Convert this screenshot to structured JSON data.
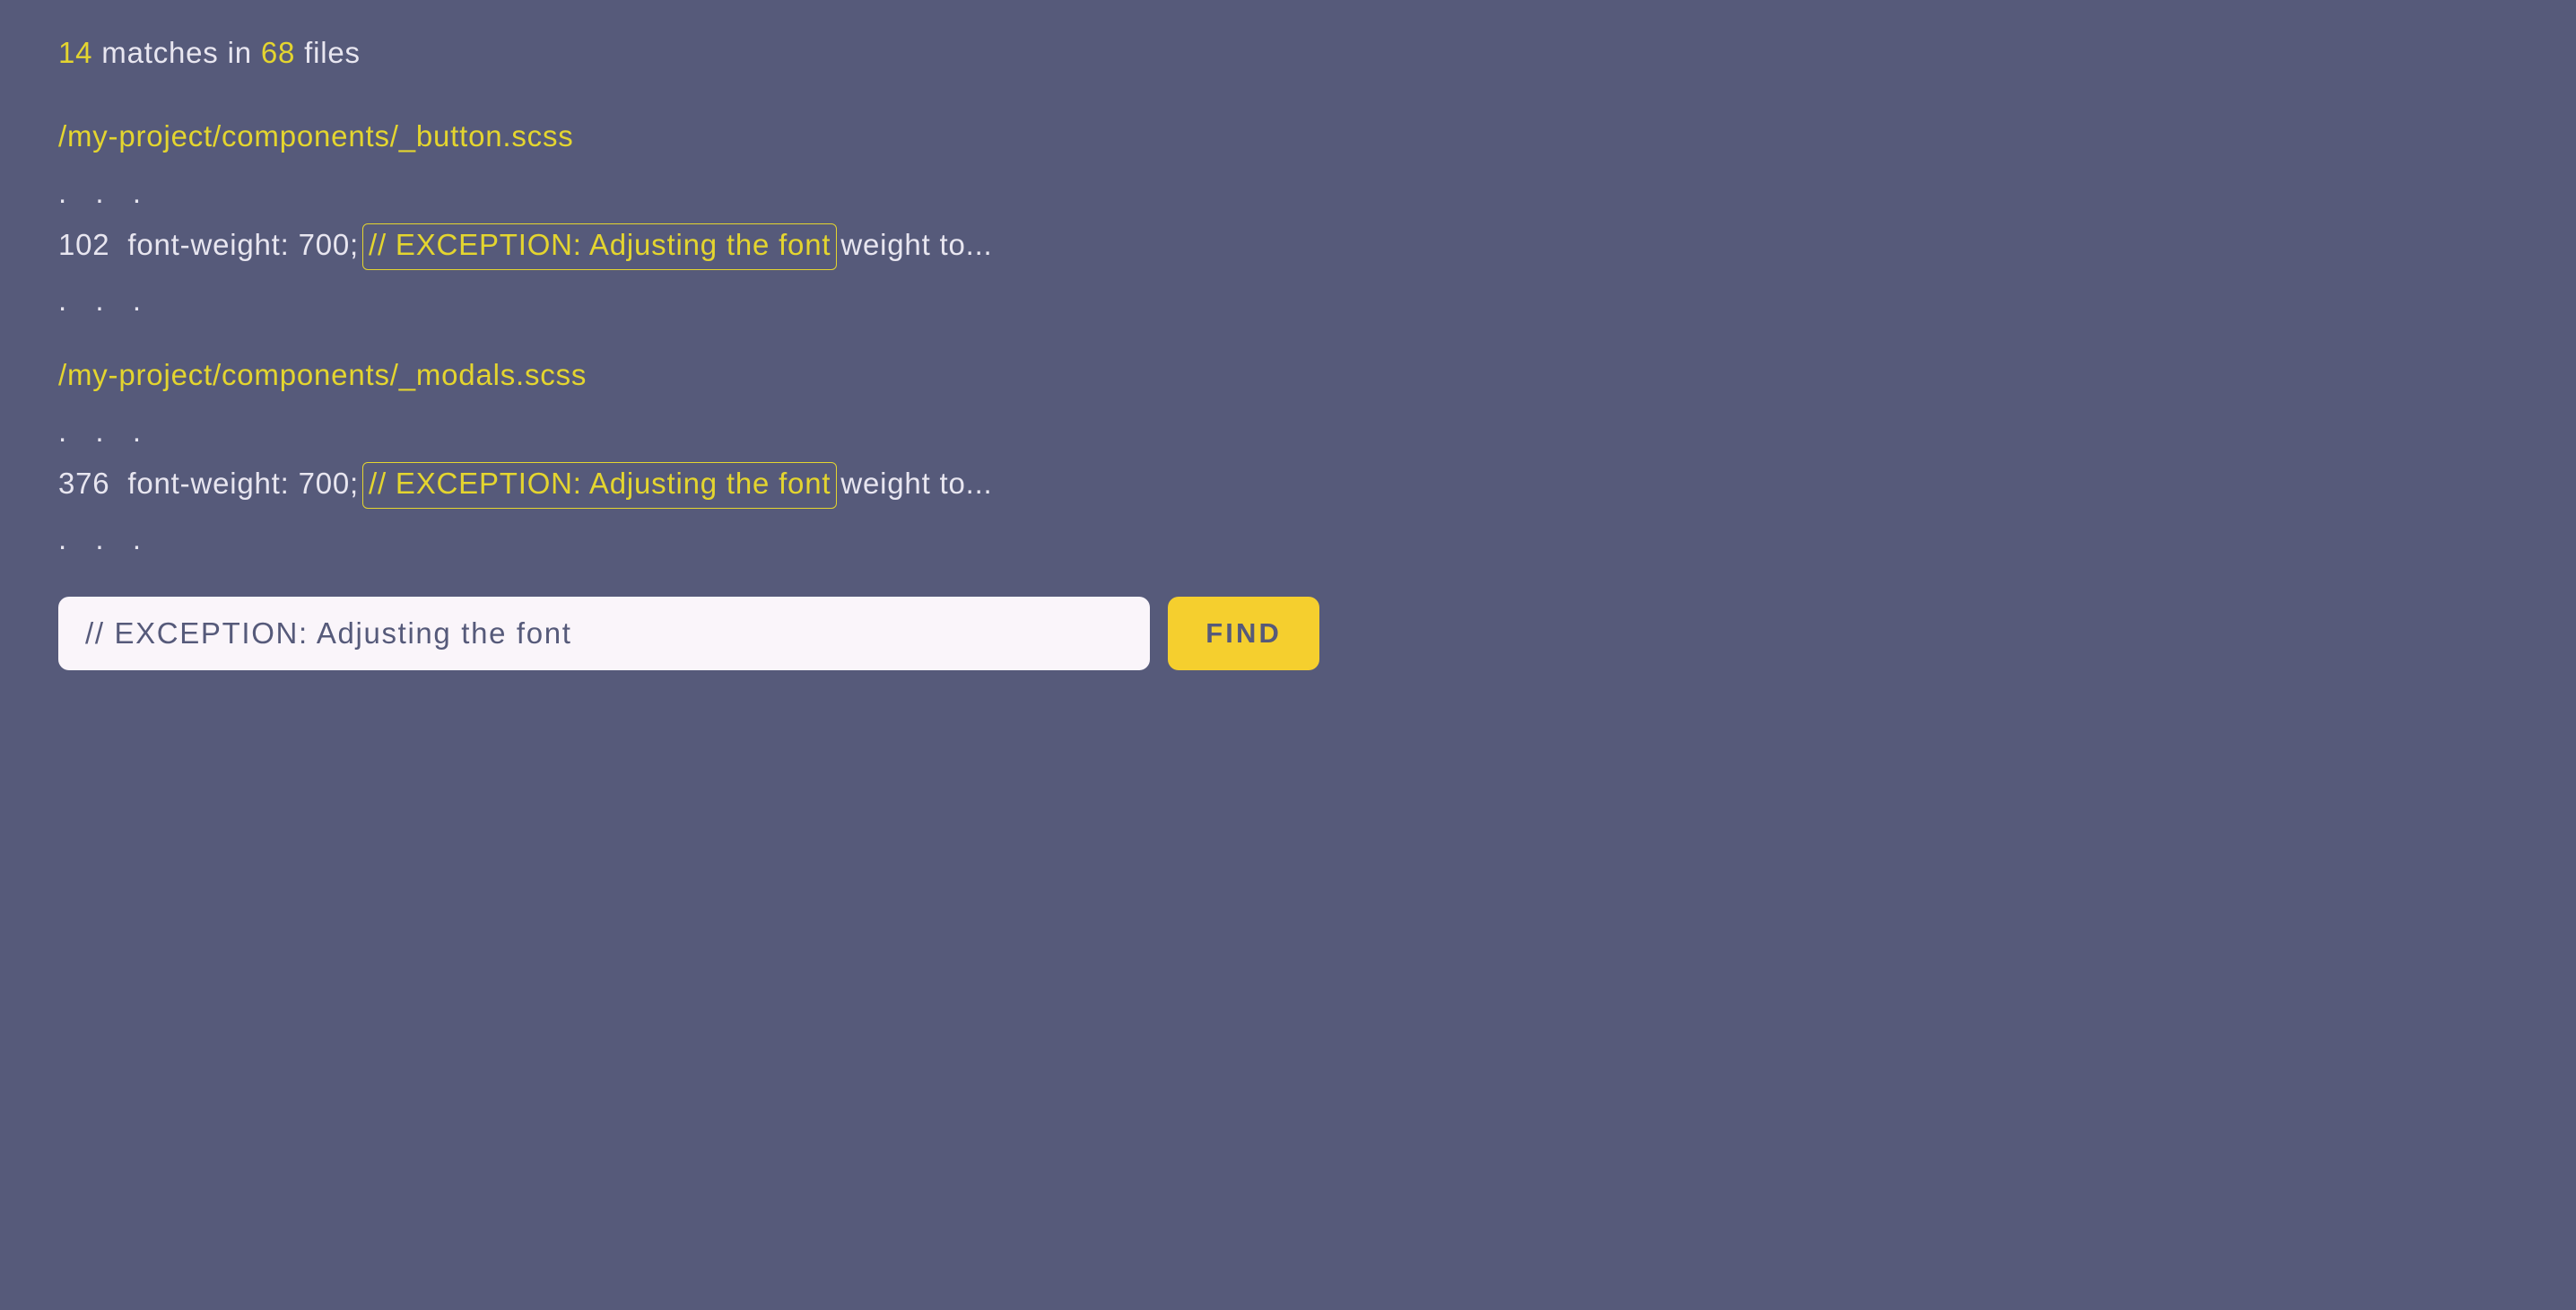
{
  "summary": {
    "match_count": "14",
    "matches_label": " matches in ",
    "file_count": "68",
    "files_label": " files"
  },
  "results": [
    {
      "path": "/my-project/components/_button.scss",
      "line_number": "102",
      "before_match": "font-weight: 700;",
      "match_text": "// EXCEPTION: Adjusting the font",
      "after_match": "weight to..."
    },
    {
      "path": "/my-project/components/_modals.scss",
      "line_number": "376",
      "before_match": "font-weight: 700;",
      "match_text": "// EXCEPTION: Adjusting the font",
      "after_match": "weight to..."
    }
  ],
  "ellipsis": ". . .",
  "search": {
    "value": "// EXCEPTION: Adjusting the font",
    "button_label": "FIND"
  }
}
